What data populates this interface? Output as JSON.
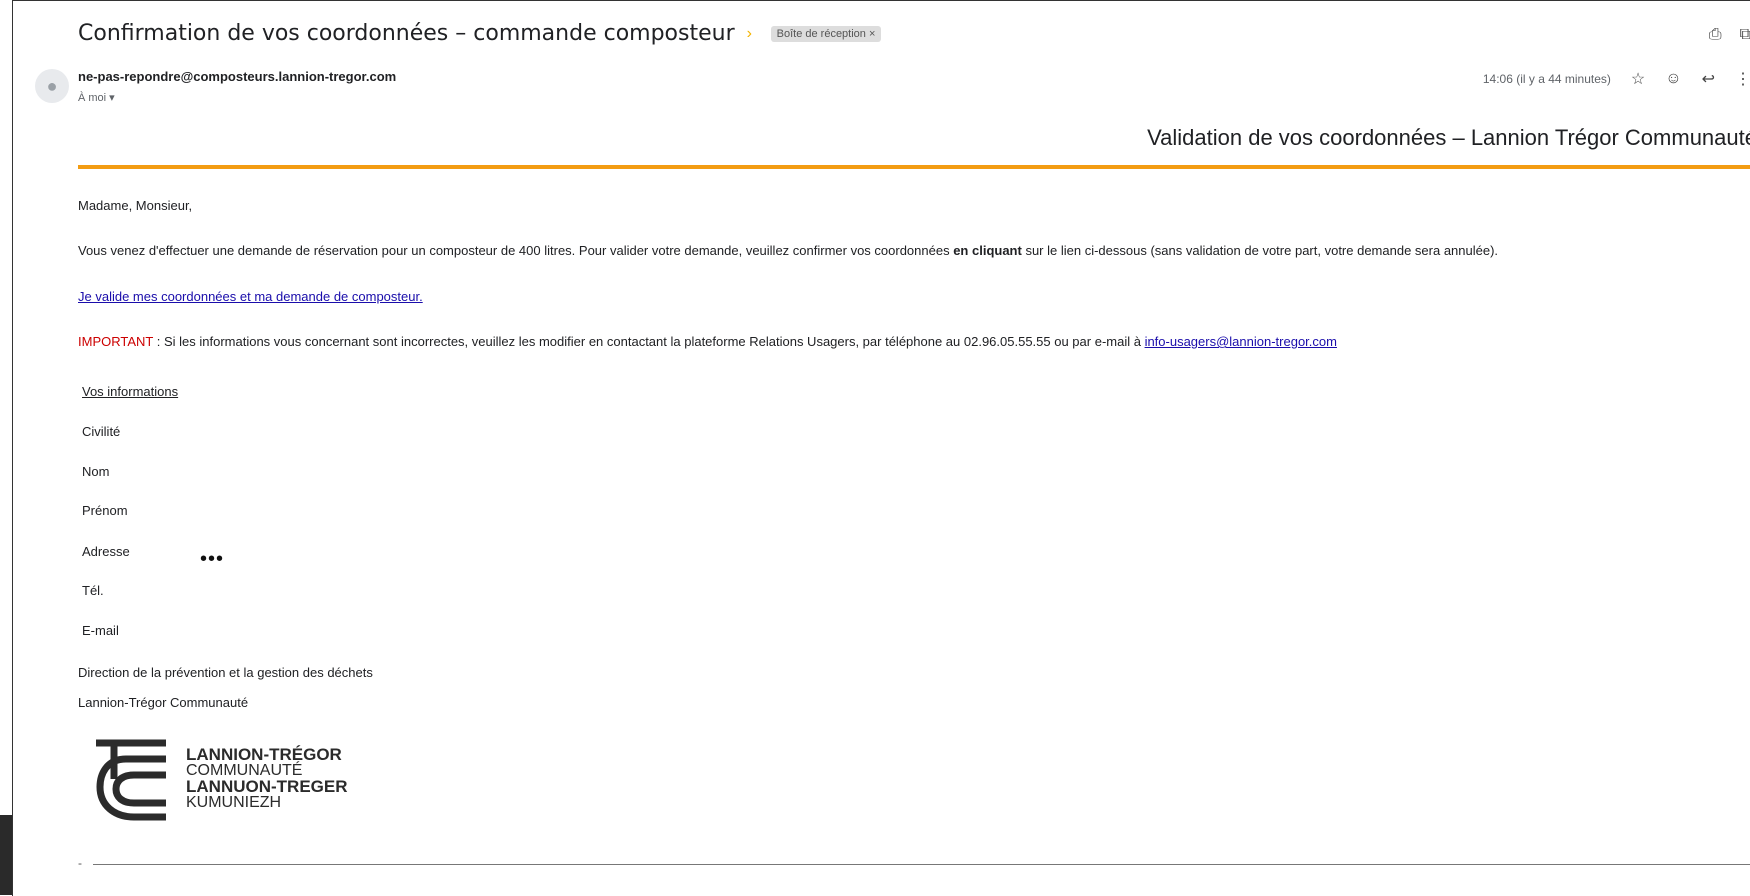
{
  "email": {
    "subject": "Confirmation de vos coordonnées – commande composteur",
    "label_chip": "Boîte de réception ×",
    "sender": "ne-pas-repondre@composteurs.lannion-tregor.com",
    "to": "À moi ▾",
    "time": "14:06 (il y a 44 minutes)"
  },
  "icons": {
    "importance": "importance-marker-icon",
    "print": "print-icon",
    "open_new": "open-new-window-icon",
    "avatar": "person-icon",
    "star": "star-icon",
    "emoji": "emoji-icon",
    "reply": "reply-icon",
    "more": "more-vert-icon"
  },
  "content": {
    "header_title": "Validation de vos coordonnées – Lannion Trégor Communauté",
    "greeting": "Madame, Monsieur,",
    "intro_before": "Vous venez d'effectuer une demande de réservation pour un composteur de 400 litres. Pour valider votre demande, veuillez confirmer vos coordonnées ",
    "intro_bold": "en cliquant",
    "intro_after": " sur le lien ci-dessous (sans validation de votre part, votre demande sera annulée).",
    "validate_link": "Je valide mes coordonnées et ma demande de composteur.",
    "important_label": "IMPORTANT",
    "important_text": " : Si les informations vous concernant sont incorrectes, veuillez les modifier en contactant la plateforme Relations Usagers, par téléphone au 02.96.05.55.55 ou par e-mail à ",
    "contact_email": "info-usagers@lannion-tregor.com",
    "info_heading": "Vos informations",
    "fields": [
      "Civilité",
      "Nom",
      "Prénom",
      "Adresse",
      "Tél.",
      "E-mail"
    ],
    "address_value": "•••",
    "signature_line1": "Direction de la prévention et la gestion des déchets",
    "signature_line2": "Lannion-Trégor Communauté",
    "footer_dash": "-"
  },
  "logo": {
    "line1": "LANNION-TRÉGOR",
    "line2": "COMMUNAUTÉ",
    "line3": "LANNUON-TREGER",
    "line4": "KUMUNIEZH"
  },
  "colors": {
    "accent_orange": "#f39c12",
    "link_blue": "#1a0dab",
    "important_red": "#cc0000"
  }
}
